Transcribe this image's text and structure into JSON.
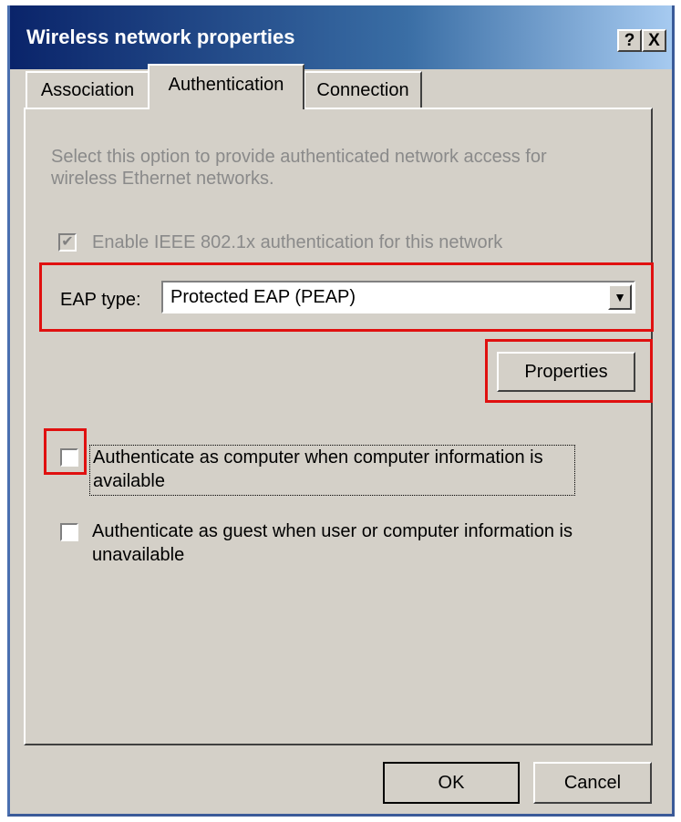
{
  "window": {
    "title": "Wireless network properties",
    "help_label": "?",
    "close_label": "X"
  },
  "tabs": [
    {
      "label": "Association",
      "active": false
    },
    {
      "label": "Authentication",
      "active": true
    },
    {
      "label": "Connection",
      "active": false
    }
  ],
  "auth": {
    "description": "Select this option to provide authenticated network access for wireless Ethernet networks.",
    "enable_8021x": {
      "label": "Enable IEEE 802.1x authentication for this network",
      "checked": true,
      "disabled": true
    },
    "eap_type_label": "EAP type:",
    "eap_type_value": "Protected EAP (PEAP)",
    "properties_label": "Properties",
    "auth_as_computer": {
      "label": "Authenticate as computer when computer information is available",
      "checked": false
    },
    "auth_as_guest": {
      "label": "Authenticate as guest when user or computer information is unavailable",
      "checked": false
    }
  },
  "footer": {
    "ok_label": "OK",
    "cancel_label": "Cancel"
  },
  "colors": {
    "highlight": "#e01010",
    "face": "#d4d0c8",
    "title_start": "#0a246a"
  }
}
